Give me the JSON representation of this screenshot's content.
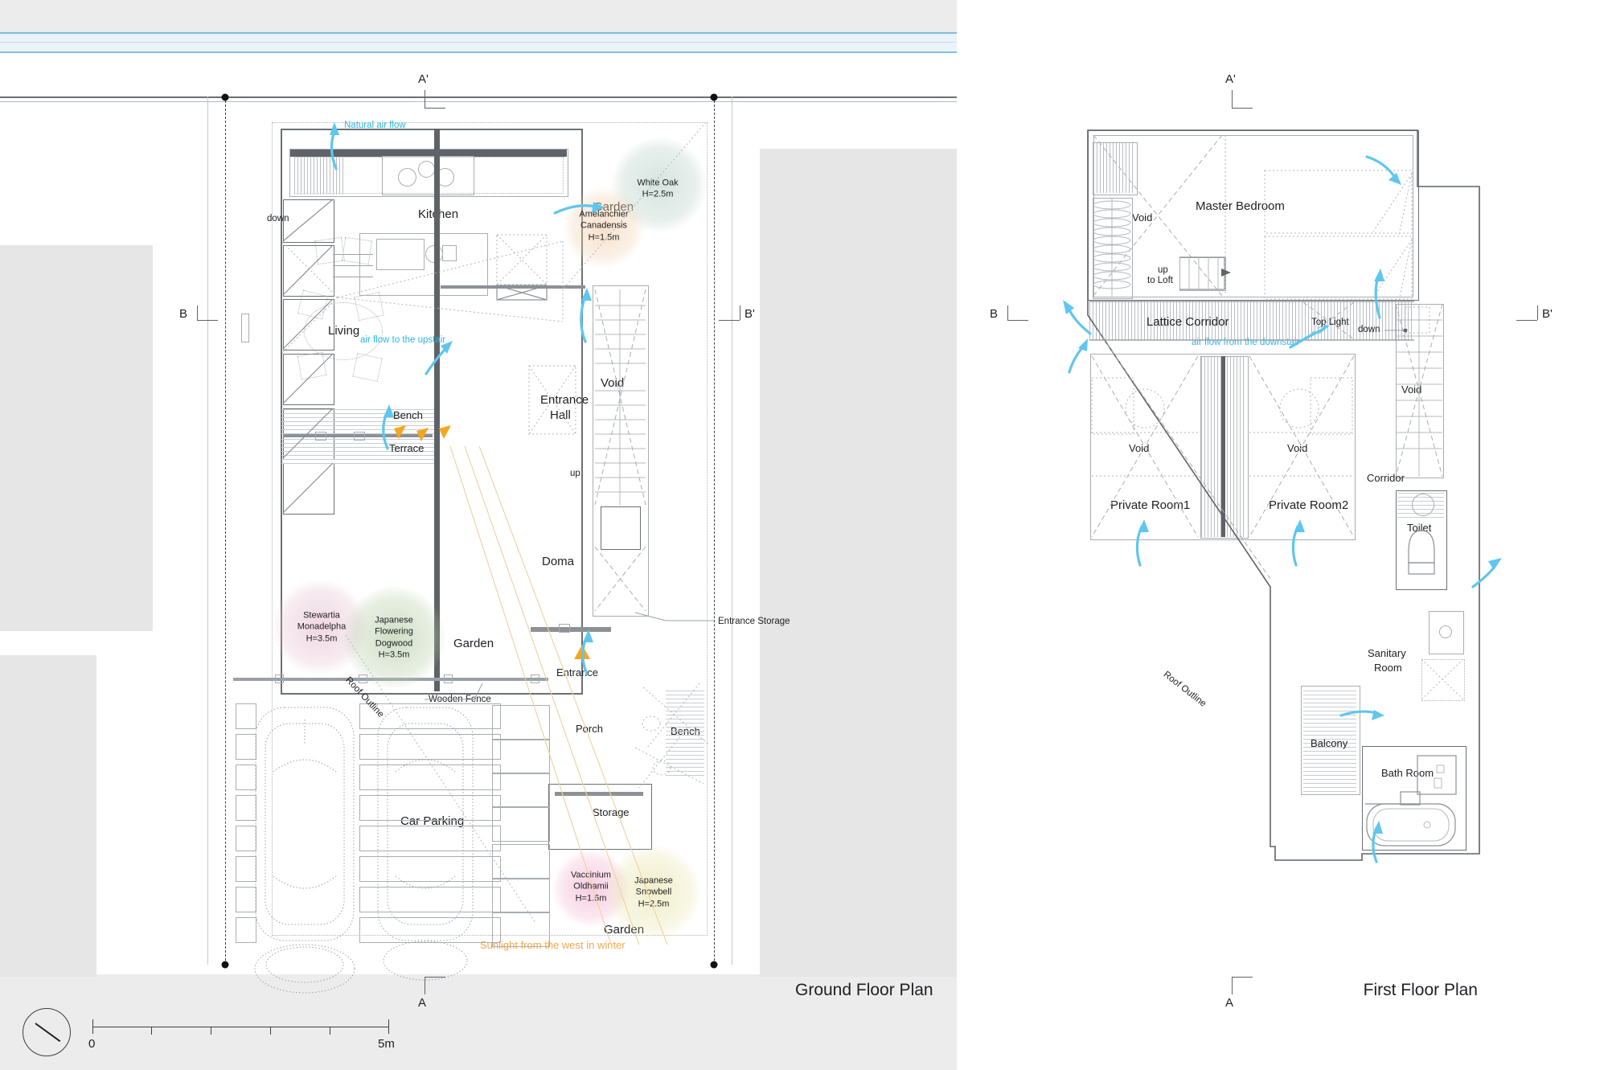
{
  "sheet": {
    "title_ground": "Ground Floor Plan",
    "title_first": "First Floor Plan"
  },
  "scale_bar": {
    "start_label": "0",
    "end_label": "5m",
    "divisions": 5,
    "compass_name": "north-arrow"
  },
  "section_marks": {
    "ground": {
      "top": "A'",
      "bottom": "A",
      "left": "B",
      "right": "B'"
    },
    "first": {
      "top": "A'",
      "bottom": "A",
      "left": "B",
      "right": "B'"
    }
  },
  "ground_floor": {
    "rooms": [
      {
        "id": "kitchen",
        "label": "Kitchen"
      },
      {
        "id": "living",
        "label": "Living"
      },
      {
        "id": "bench",
        "label": "Bench"
      },
      {
        "id": "terrace",
        "label": "Terrace"
      },
      {
        "id": "garden-north",
        "label": "Garden"
      },
      {
        "id": "garden-west",
        "label": "Garden"
      },
      {
        "id": "garden-south",
        "label": "Garden"
      },
      {
        "id": "entrance-hall",
        "label": "Entrance\nHall"
      },
      {
        "id": "void",
        "label": "Void"
      },
      {
        "id": "doma",
        "label": "Doma"
      },
      {
        "id": "entrance",
        "label": "Entrance"
      },
      {
        "id": "porch",
        "label": "Porch"
      },
      {
        "id": "bench-porch",
        "label": "Bench"
      },
      {
        "id": "storage",
        "label": "Storage"
      },
      {
        "id": "car-parking",
        "label": "Car Parking"
      }
    ],
    "entrance_hall_line1": "Entrance",
    "entrance_hall_line2": "Hall",
    "annotations": [
      {
        "id": "natural-air-flow",
        "text": "Natural air flow",
        "kind": "air"
      },
      {
        "id": "air-flow-upstair",
        "text": "air flow to the upstair",
        "kind": "air"
      },
      {
        "id": "sunlight-west-winter",
        "text": "Sunlight from the west in winter",
        "kind": "sun"
      },
      {
        "id": "wooden-fence",
        "text": "Wooden Fence",
        "kind": "callout"
      },
      {
        "id": "entrance-storage",
        "text": "Entrance Storage",
        "kind": "callout"
      },
      {
        "id": "roof-outline",
        "text": "Roof Outline",
        "kind": "callout"
      },
      {
        "id": "stair-down",
        "text": "down",
        "kind": "stair"
      },
      {
        "id": "stair-up",
        "text": "up",
        "kind": "stair"
      }
    ],
    "plants": [
      {
        "id": "white-oak",
        "name": "White Oak",
        "height": "H=2.5m"
      },
      {
        "id": "amelanchier-canadensis",
        "name": "Amelanchier\nCanadensis",
        "name1": "Amelanchier",
        "name2": "Canadensis",
        "height": "H=1.5m"
      },
      {
        "id": "stewartia-monadelpha",
        "name1": "Stewartia",
        "name2": "Monadelpha",
        "height": "H=3.5m"
      },
      {
        "id": "japanese-flowering-dogwood",
        "name1": "Japanese",
        "name2": "Flowering",
        "name3": "Dogwood",
        "height": "H=3.5m"
      },
      {
        "id": "vaccinium-oldhamii",
        "name1": "Vaccinium",
        "name2": "Oldhamii",
        "height": "H=1.5m"
      },
      {
        "id": "japanese-snowbell",
        "name1": "Japanese",
        "name2": "Snowbell",
        "height": "H=2.5m"
      }
    ]
  },
  "first_floor": {
    "rooms": [
      {
        "id": "master-bedroom",
        "label": "Master Bedroom"
      },
      {
        "id": "void-bedroom",
        "label": "Void"
      },
      {
        "id": "lattice-corridor",
        "label": "Lattice Corridor"
      },
      {
        "id": "top-light",
        "label": "Top Light"
      },
      {
        "id": "void-left",
        "label": "Void"
      },
      {
        "id": "void-right",
        "label": "Void"
      },
      {
        "id": "private-room-1",
        "label": "Private Room1"
      },
      {
        "id": "private-room-2",
        "label": "Private Room2"
      },
      {
        "id": "void-stair",
        "label": "Void"
      },
      {
        "id": "corridor",
        "label": "Corridor"
      },
      {
        "id": "toilet",
        "label": "Toilet"
      },
      {
        "id": "sanitary-room",
        "label": "Sanitary\nRoom"
      },
      {
        "id": "sanitary-room-l1",
        "label": "Sanitary"
      },
      {
        "id": "sanitary-room-l2",
        "label": "Room"
      },
      {
        "id": "balcony",
        "label": "Balcony"
      },
      {
        "id": "bath-room",
        "label": "Bath Room"
      }
    ],
    "annotations": [
      {
        "id": "air-flow-downstair",
        "text": "air flow from the downstair",
        "kind": "air"
      },
      {
        "id": "roof-outline",
        "text": "Roof Outline",
        "kind": "callout"
      },
      {
        "id": "stair-up-to-loft-l1",
        "text": "up",
        "kind": "stair"
      },
      {
        "id": "stair-up-to-loft-l2",
        "text": "to Loft",
        "kind": "stair"
      },
      {
        "id": "stair-down",
        "text": "down",
        "kind": "stair"
      }
    ]
  },
  "colors": {
    "air_flow": "#29b6e8",
    "sunlight": "#f0a94c",
    "wall": "#5f6368",
    "site_band": "#e8e8e8",
    "road": "#eef4f9"
  }
}
